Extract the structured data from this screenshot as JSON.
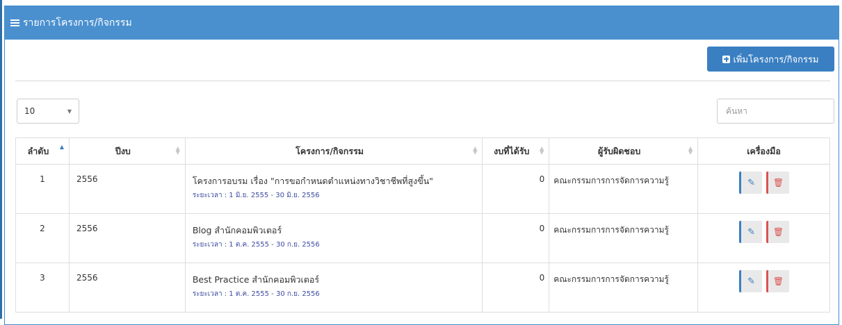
{
  "panel": {
    "title": "รายการโครงการ/กิจกรรม",
    "icon": "list-icon"
  },
  "toolbar": {
    "add_label": "เพิ่มโครงการ/กิจกรรม",
    "add_icon": "plus-square-icon"
  },
  "controls": {
    "page_length": "10",
    "search_placeholder": "ค้นหา"
  },
  "table": {
    "columns": [
      "ลำดับ",
      "ปีงบ",
      "โครงการ/กิจกรรม",
      "งบที่ได้รับ",
      "ผู้รับผิดชอบ",
      "เครื่องมือ"
    ],
    "rows": [
      {
        "num": "1",
        "year": "2556",
        "name": "โครงการอบรม เรื่อง \"การขอกำหนดตำแหน่งทางวิชาชีพที่สูงขึ้น\"",
        "period": "ระยะเวลา : 1 มิ.ย. 2555 - 30 มิ.ย. 2556",
        "budget": "0",
        "owner": "คณะกรรมการการจัดการความรู้"
      },
      {
        "num": "2",
        "year": "2556",
        "name": "Blog สำนักคอมพิวเตอร์",
        "period": "ระยะเวลา : 1 ต.ค. 2555 - 30 ก.ย. 2556",
        "budget": "0",
        "owner": "คณะกรรมการการจัดการความรู้"
      },
      {
        "num": "3",
        "year": "2556",
        "name": "Best Practice สำนักคอมพิวเตอร์",
        "period": "ระยะเวลา : 1 ต.ค. 2555 - 30 ก.ย. 2556",
        "budget": "0",
        "owner": "คณะกรรมการการจัดการความรู้"
      }
    ]
  },
  "colors": {
    "header_bg": "#4a90cf",
    "button_bg": "#3a7fc2",
    "period_text": "#3c4aa1",
    "delete": "#d9534f"
  }
}
